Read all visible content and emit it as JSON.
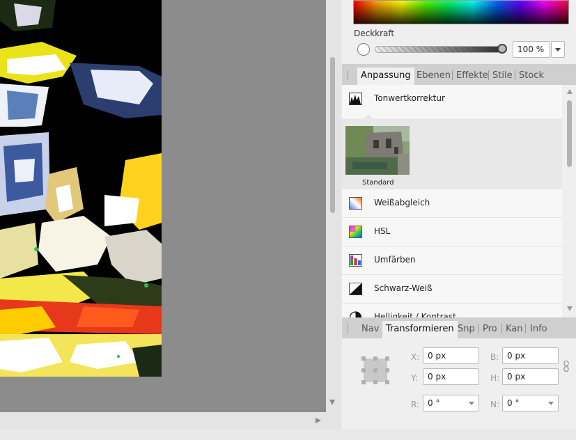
{
  "color_panel": {
    "opacity_label": "Deckkraft",
    "opacity_value": "100 %",
    "opacity_fraction": 1.0
  },
  "studio_tabs": [
    {
      "label": "Anpassung",
      "active": true
    },
    {
      "label": "Ebenen",
      "active": false
    },
    {
      "label": "Effekte",
      "active": false
    },
    {
      "label": "Stile",
      "active": false
    },
    {
      "label": "Stock",
      "active": false
    }
  ],
  "adjustments": {
    "expanded": {
      "label": "Tonwertkorrektur",
      "icon": "levels-icon",
      "preset_label": "Standard"
    },
    "items": [
      {
        "label": "Weißabgleich",
        "icon": "white-balance-icon"
      },
      {
        "label": "HSL",
        "icon": "hsl-icon"
      },
      {
        "label": "Umfärben",
        "icon": "recolor-icon"
      },
      {
        "label": "Schwarz-Weiß",
        "icon": "black-white-icon"
      },
      {
        "label": "Helligkeit / Kontrast",
        "icon": "brightness-contrast-icon"
      }
    ]
  },
  "transform_tabs": [
    {
      "label": "Nav",
      "active": false
    },
    {
      "label": "Transformieren",
      "active": true
    },
    {
      "label": "Snp",
      "active": false
    },
    {
      "label": "Pro",
      "active": false
    },
    {
      "label": "Kan",
      "active": false
    },
    {
      "label": "Info",
      "active": false
    }
  ],
  "transform": {
    "x_label": "X:",
    "x_value": "0 px",
    "y_label": "Y:",
    "y_value": "0 px",
    "w_label": "B:",
    "w_value": "0 px",
    "h_label": "H:",
    "h_value": "0 px",
    "r_label": "R:",
    "r_value": "0 °",
    "s_label": "N:",
    "s_value": "0 °"
  },
  "colors": {
    "panel_bg": "#efefef",
    "tab_bar": "#cfcfcf",
    "canvas_bg": "#8c8c8c"
  }
}
